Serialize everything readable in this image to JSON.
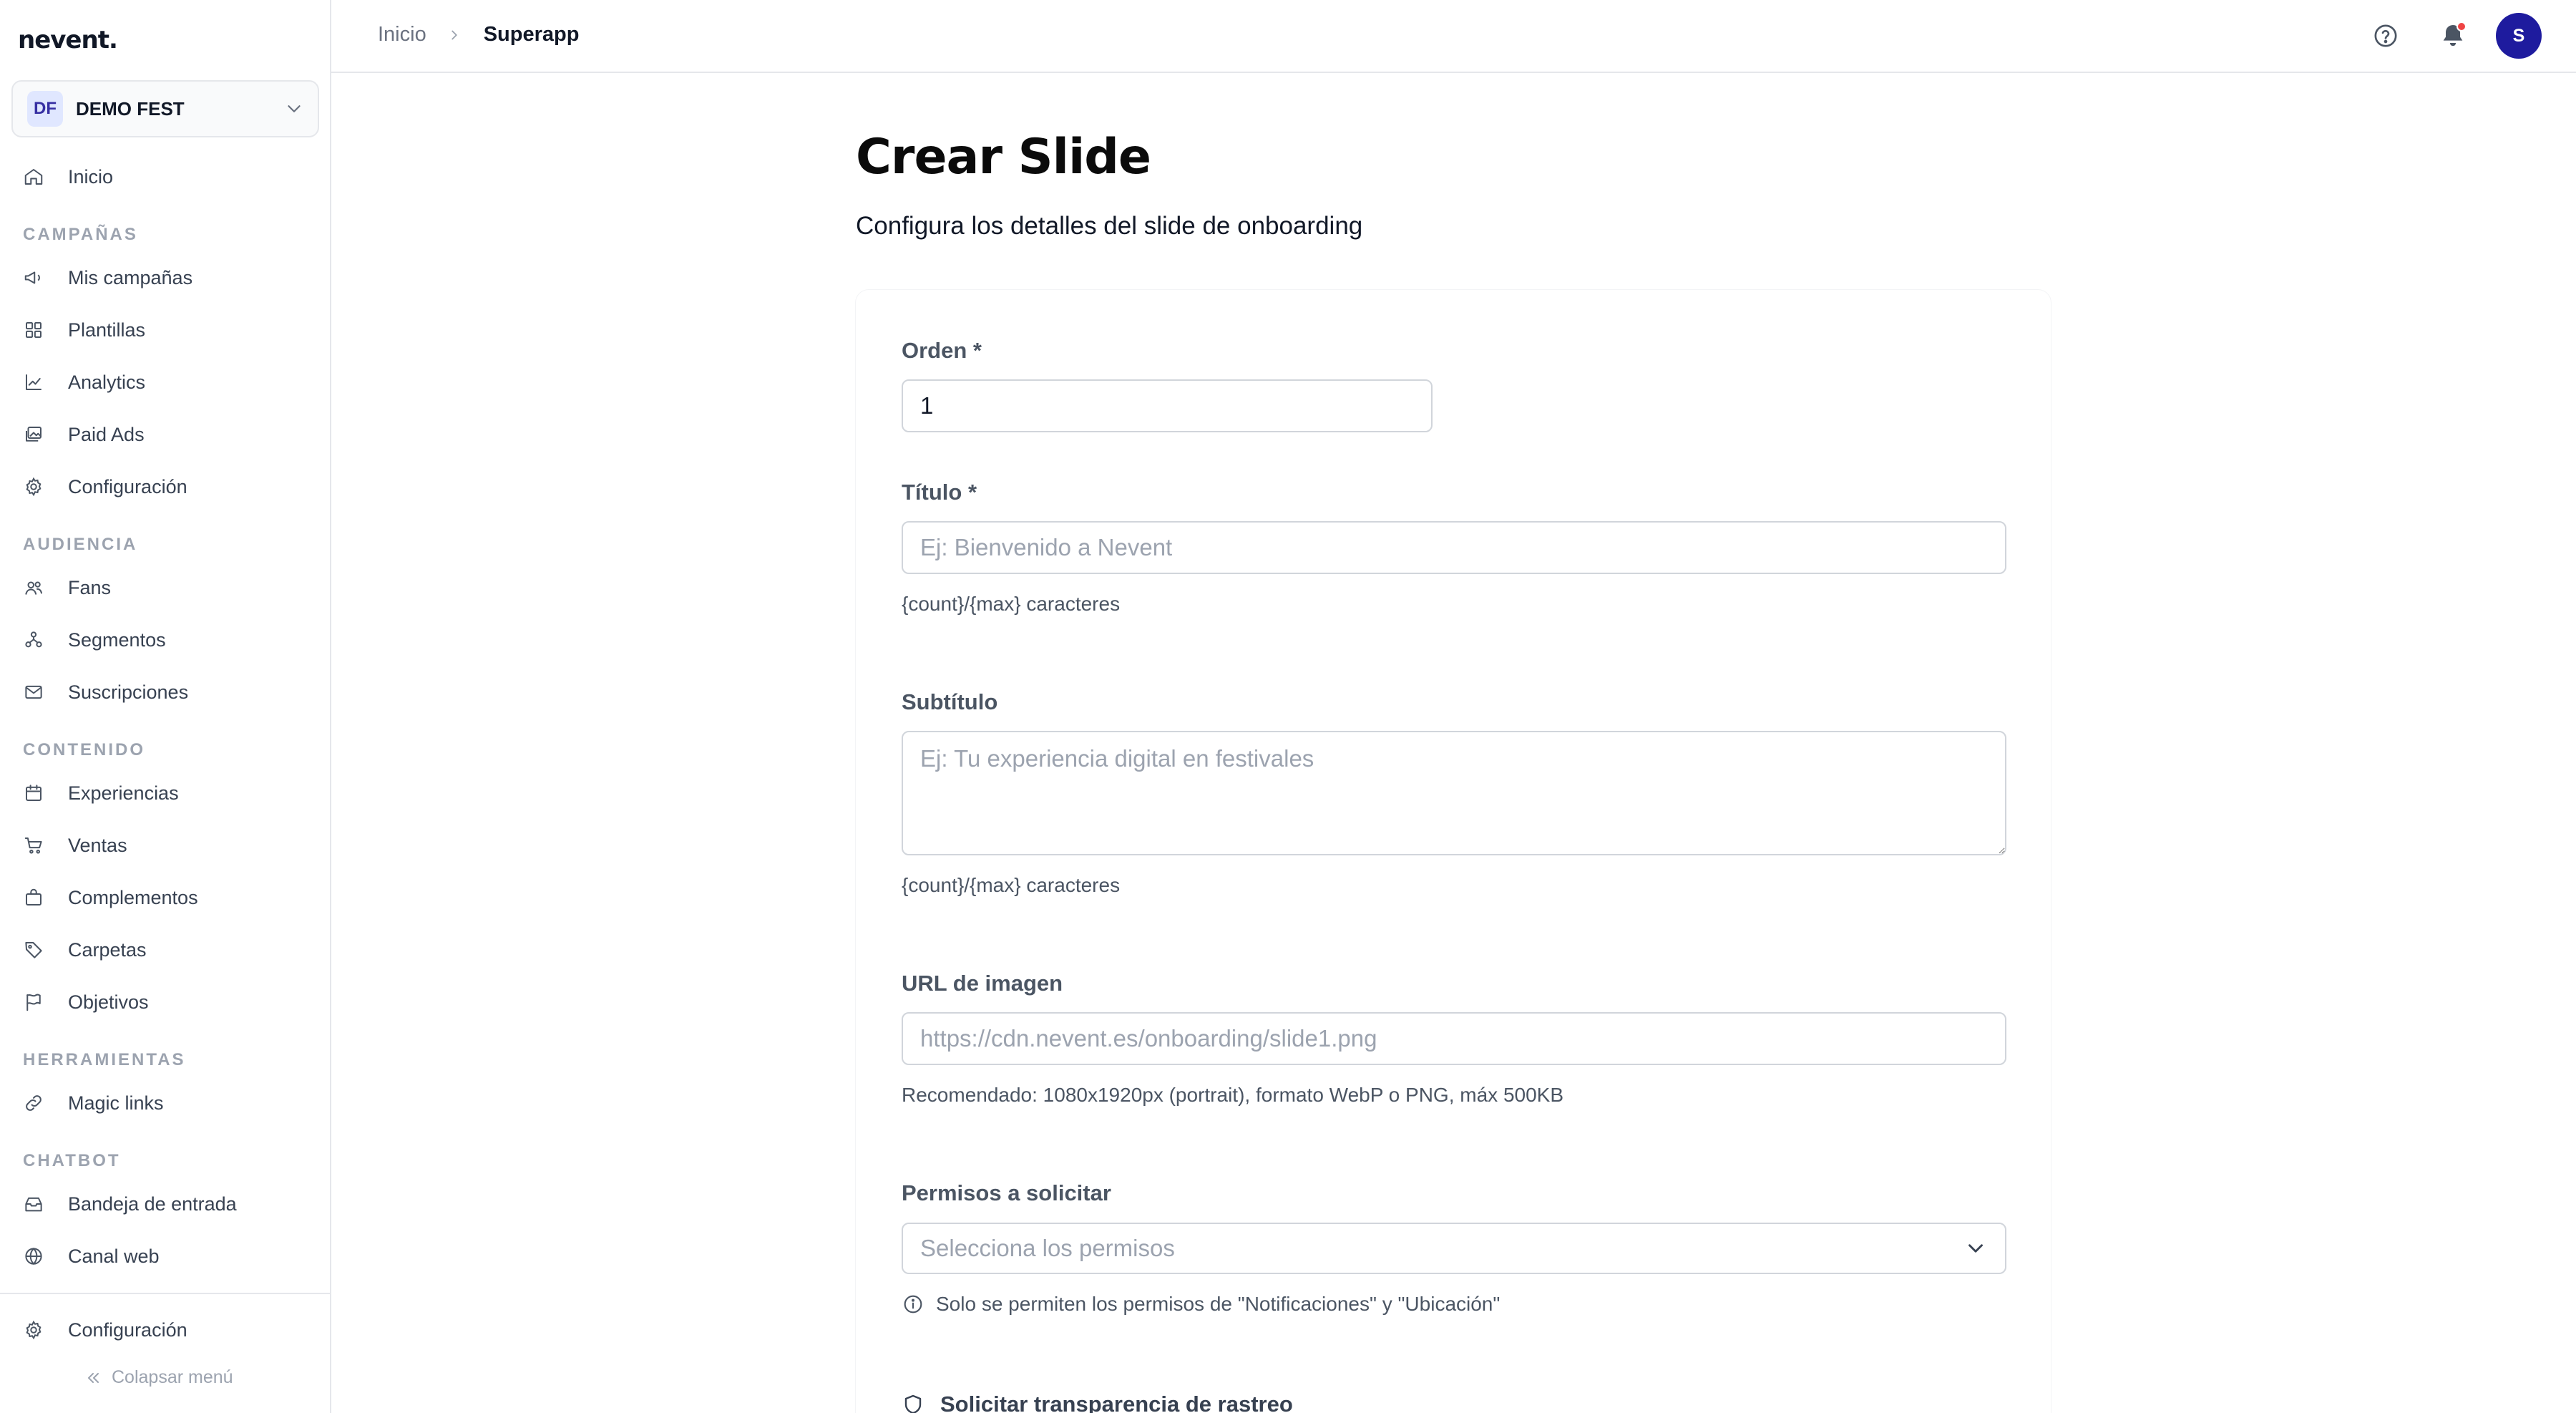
{
  "app": {
    "logo": "nevent."
  },
  "workspace": {
    "initials": "DF",
    "name": "DEMO FEST"
  },
  "sidebar": {
    "home": "Inicio",
    "sections": [
      {
        "title": "CAMPAÑAS",
        "items": [
          "Mis campañas",
          "Plantillas",
          "Analytics",
          "Paid Ads",
          "Configuración"
        ]
      },
      {
        "title": "AUDIENCIA",
        "items": [
          "Fans",
          "Segmentos",
          "Suscripciones"
        ]
      },
      {
        "title": "CONTENIDO",
        "items": [
          "Experiencias",
          "Ventas",
          "Complementos",
          "Carpetas",
          "Objetivos"
        ]
      },
      {
        "title": "HERRAMIENTAS",
        "items": [
          "Magic links"
        ]
      },
      {
        "title": "CHATBOT",
        "items": [
          "Bandeja de entrada",
          "Canal web"
        ]
      }
    ],
    "settings": "Configuración",
    "collapse": "Colapsar menú"
  },
  "breadcrumb": {
    "home": "Inicio",
    "current": "Superapp"
  },
  "user": {
    "initial": "S"
  },
  "colors": {
    "accent": "#1e1b9e",
    "notification": "#ef4444"
  },
  "page": {
    "title": "Crear Slide",
    "subtitle": "Configura los detalles del slide de onboarding"
  },
  "form": {
    "order": {
      "label": "Orden *",
      "value": "1"
    },
    "title": {
      "label": "Título *",
      "placeholder": "Ej: Bienvenido a Nevent",
      "helper": "{count}/{max} caracteres"
    },
    "subtitle": {
      "label": "Subtítulo",
      "placeholder": "Ej: Tu experiencia digital en festivales",
      "helper": "{count}/{max} caracteres"
    },
    "image": {
      "label": "URL de imagen",
      "placeholder": "https://cdn.nevent.es/onboarding/slide1.png",
      "helper": "Recomendado: 1080x1920px (portrait), formato WebP o PNG, máx 500KB"
    },
    "permissions": {
      "label": "Permisos a solicitar",
      "placeholder": "Selecciona los permisos",
      "info": "Solo se permiten los permisos de \"Notificaciones\" y \"Ubicación\""
    },
    "tracking": {
      "label": "Solicitar transparencia de rastreo"
    }
  }
}
